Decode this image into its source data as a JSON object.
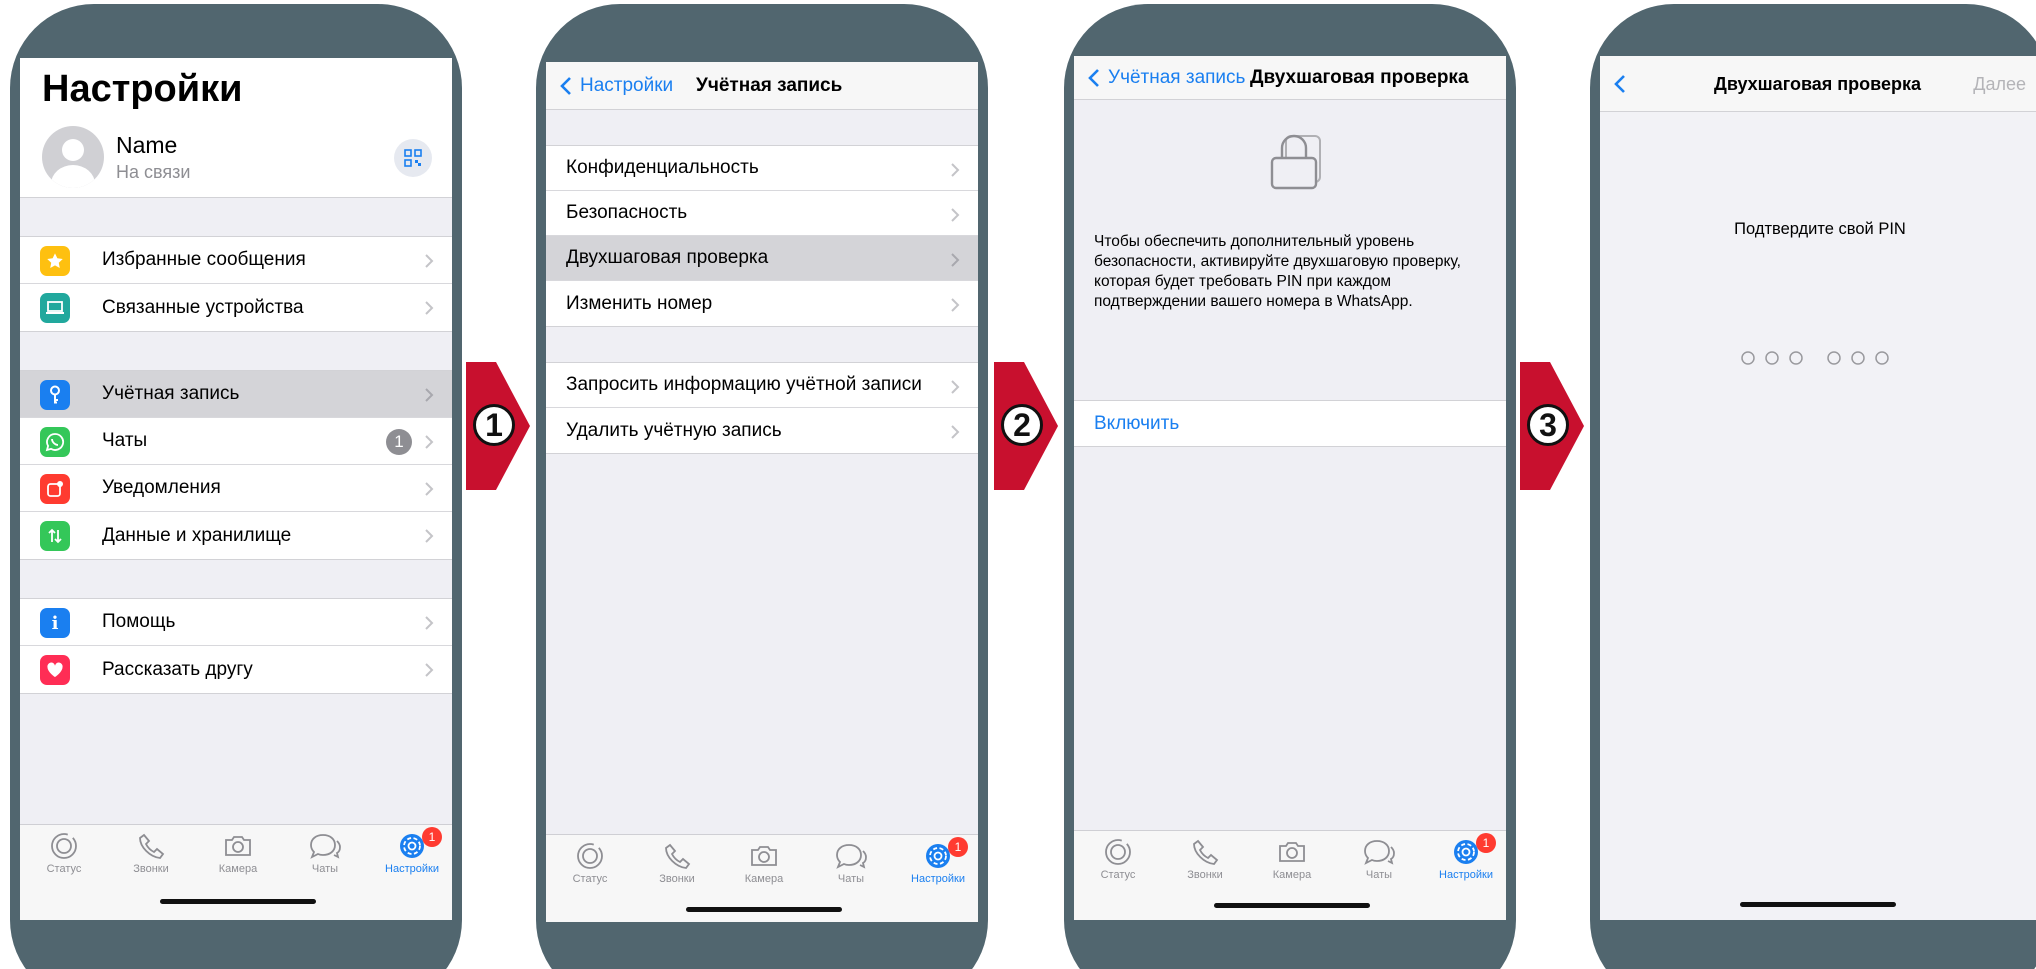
{
  "steps": [
    "1",
    "2",
    "3"
  ],
  "screen1": {
    "title": "Настройки",
    "profile": {
      "name": "Name",
      "status": "На связи"
    },
    "group1": [
      {
        "label": "Избранные сообщения",
        "icon": "star-icon",
        "color": "#fec010"
      },
      {
        "label": "Связанные устройства",
        "icon": "laptop-icon",
        "color": "#21a89d"
      }
    ],
    "group2": [
      {
        "label": "Учётная запись",
        "icon": "key-icon",
        "color": "#1a7ff0"
      },
      {
        "label": "Чаты",
        "icon": "whatsapp-icon",
        "color": "#34c759",
        "badge": "1"
      },
      {
        "label": "Уведомления",
        "icon": "notification-icon",
        "color": "#ff3b30"
      },
      {
        "label": "Данные и хранилище",
        "icon": "data-arrows-icon",
        "color": "#34c759"
      }
    ],
    "group3": [
      {
        "label": "Помощь",
        "icon": "info-icon",
        "color": "#1a7ff0"
      },
      {
        "label": "Рассказать другу",
        "icon": "heart-icon",
        "color": "#ff2d55"
      }
    ]
  },
  "tabbar": {
    "tabs": [
      "Статус",
      "Звонки",
      "Камера",
      "Чаты",
      "Настройки"
    ],
    "badge": "1"
  },
  "screen2": {
    "back": "Настройки",
    "title": "Учётная запись",
    "group1": [
      "Конфиденциальность",
      "Безопасность",
      "Двухшаговая проверка",
      "Изменить номер"
    ],
    "group2": [
      "Запросить информацию учётной записи",
      "Удалить учётную запись"
    ]
  },
  "screen3": {
    "back": "Учётная запись",
    "title": "Двухшаговая проверка",
    "description": "Чтобы обеспечить дополнительный уровень безопасности, активируйте двухшаговую проверку, которая будет требовать PIN при каждом подтверждении вашего номера в WhatsApp.",
    "enable": "Включить"
  },
  "screen4": {
    "title": "Двухшаговая проверка",
    "next": "Далее",
    "prompt": "Подтвердите свой PIN"
  },
  "colors": {
    "accent": "#1a7ff0",
    "step_red": "#c8102e",
    "frame": "#51666f"
  }
}
